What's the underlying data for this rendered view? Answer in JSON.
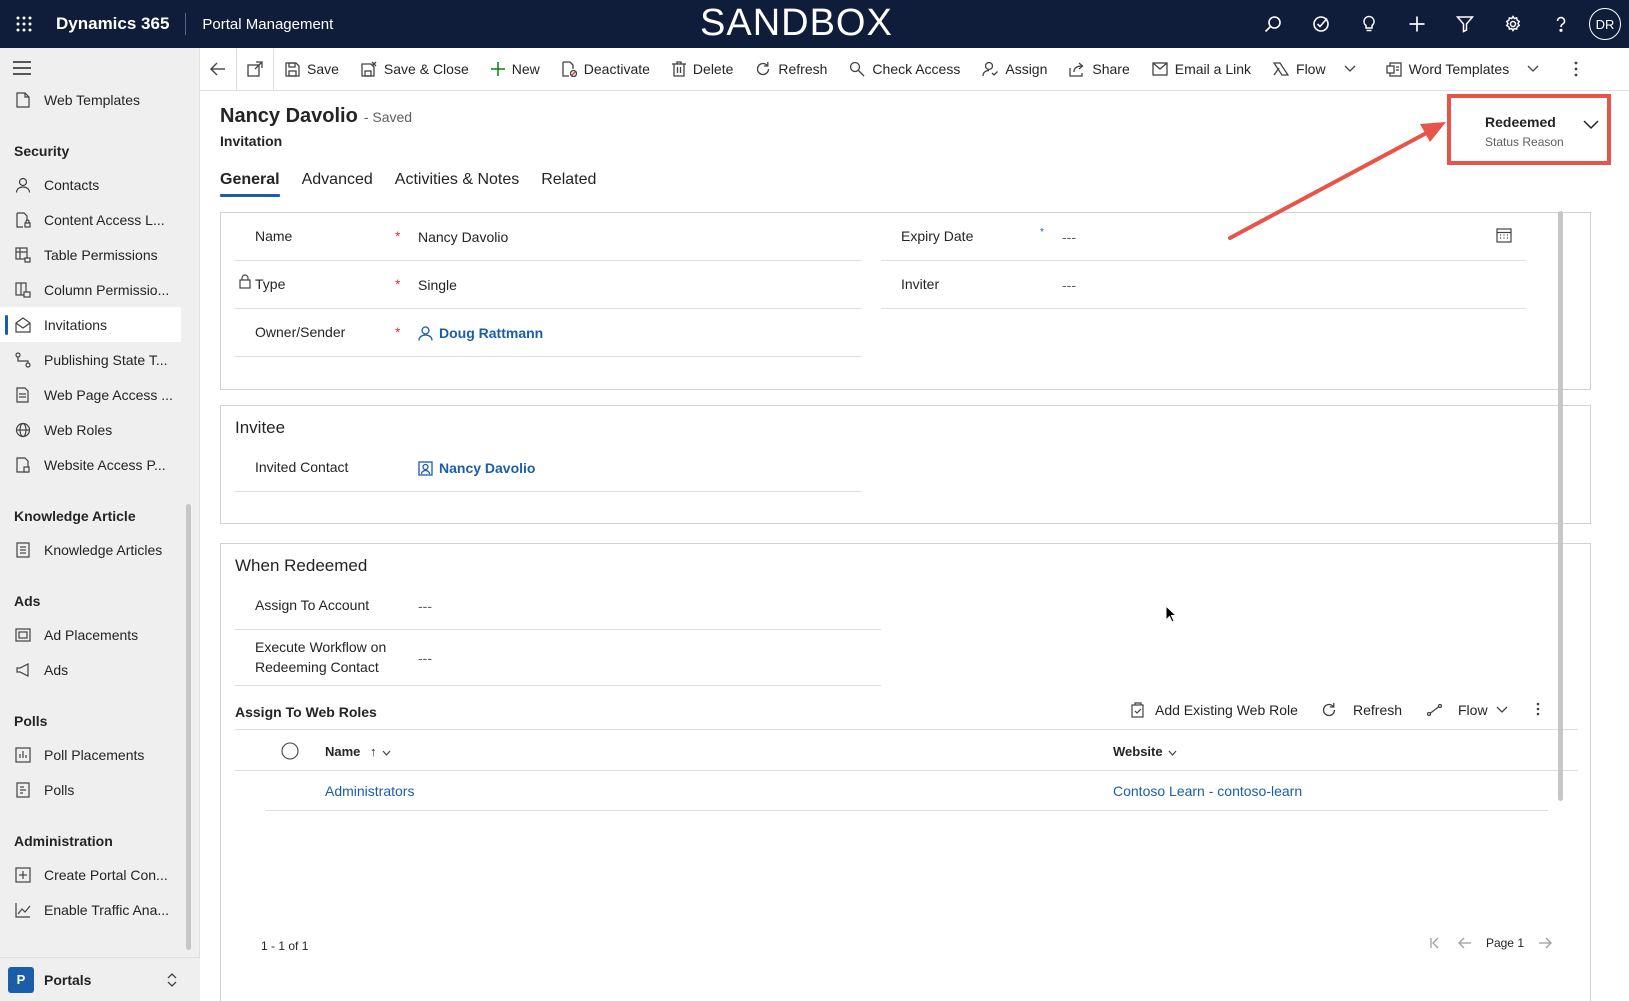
{
  "topbar": {
    "app_name": "Dynamics 365",
    "area_name": "Portal Management",
    "environment": "SANDBOX",
    "icons": [
      "search-icon",
      "task-icon",
      "lightbulb-icon",
      "plus-icon",
      "filter-icon",
      "settings-icon",
      "help-icon"
    ],
    "user_initials": "DR"
  },
  "sidebar": {
    "top_items": [
      {
        "label": "Web Templates",
        "icon": "document-icon"
      }
    ],
    "groups": [
      {
        "title": "Security",
        "items": [
          {
            "label": "Contacts",
            "icon": "person-icon"
          },
          {
            "label": "Content Access L...",
            "icon": "document-lock-icon"
          },
          {
            "label": "Table Permissions",
            "icon": "table-lock-icon"
          },
          {
            "label": "Column Permissio...",
            "icon": "column-icon"
          },
          {
            "label": "Invitations",
            "icon": "mail-icon",
            "active": true
          },
          {
            "label": "Publishing State T...",
            "icon": "flow-icon"
          },
          {
            "label": "Web Page Access ...",
            "icon": "page-access-icon"
          },
          {
            "label": "Web Roles",
            "icon": "globe-icon"
          },
          {
            "label": "Website Access P...",
            "icon": "website-access-icon"
          }
        ]
      },
      {
        "title": "Knowledge Article",
        "items": [
          {
            "label": "Knowledge Articles",
            "icon": "article-icon"
          }
        ]
      },
      {
        "title": "Ads",
        "items": [
          {
            "label": "Ad Placements",
            "icon": "placement-icon"
          },
          {
            "label": "Ads",
            "icon": "megaphone-icon"
          }
        ]
      },
      {
        "title": "Polls",
        "items": [
          {
            "label": "Poll Placements",
            "icon": "poll-placement-icon"
          },
          {
            "label": "Polls",
            "icon": "poll-icon"
          }
        ]
      },
      {
        "title": "Administration",
        "items": [
          {
            "label": "Create Portal Con...",
            "icon": "add-box-icon"
          },
          {
            "label": "Enable Traffic Ana...",
            "icon": "chart-icon"
          }
        ]
      }
    ],
    "footer": {
      "badge": "P",
      "label": "Portals"
    }
  },
  "commandbar": {
    "items": [
      {
        "label": "Save",
        "icon": "save-icon"
      },
      {
        "label": "Save & Close",
        "icon": "save-close-icon"
      },
      {
        "label": "New",
        "icon": "plus-icon"
      },
      {
        "label": "Deactivate",
        "icon": "deactivate-icon"
      },
      {
        "label": "Delete",
        "icon": "trash-icon"
      },
      {
        "label": "Refresh",
        "icon": "refresh-icon"
      },
      {
        "label": "Check Access",
        "icon": "check-access-icon"
      },
      {
        "label": "Assign",
        "icon": "assign-icon"
      },
      {
        "label": "Share",
        "icon": "share-icon"
      },
      {
        "label": "Email a Link",
        "icon": "email-icon"
      },
      {
        "label": "Flow",
        "icon": "flow-icon"
      },
      {
        "label": "Word Templates",
        "icon": "word-icon"
      }
    ]
  },
  "record": {
    "title": "Nancy Davolio",
    "saved_state": "- Saved",
    "entity": "Invitation",
    "status_value": "Redeemed",
    "status_label": "Status Reason"
  },
  "tabs": [
    {
      "label": "General",
      "active": true
    },
    {
      "label": "Advanced"
    },
    {
      "label": "Activities & Notes"
    },
    {
      "label": "Related"
    }
  ],
  "general": {
    "name_label": "Name",
    "name_value": "Nancy Davolio",
    "type_label": "Type",
    "type_value": "Single",
    "owner_label": "Owner/Sender",
    "owner_value": "Doug Rattmann",
    "expiry_label": "Expiry Date",
    "expiry_value": "---",
    "inviter_label": "Inviter",
    "inviter_value": "---",
    "required_mark": "*",
    "recommended_mark": "*"
  },
  "invitee": {
    "title": "Invitee",
    "contact_label": "Invited Contact",
    "contact_value": "Nancy Davolio"
  },
  "redeemed": {
    "title": "When Redeemed",
    "account_label": "Assign To Account",
    "account_value": "---",
    "workflow_label_1": "Execute Workflow on",
    "workflow_label_2": "Redeeming Contact",
    "workflow_value": "---",
    "grid": {
      "title": "Assign To Web Roles",
      "add_label": "Add Existing Web Role",
      "refresh_label": "Refresh",
      "flow_label": "Flow",
      "columns": [
        "Name",
        "Website"
      ],
      "rows": [
        {
          "name": "Administrators",
          "website": "Contoso Learn - contoso-learn"
        }
      ],
      "count": "1 - 1 of 1",
      "page": "Page 1"
    }
  },
  "colors": {
    "nav": "#0f1c3a",
    "accent": "#1a5ea9",
    "highlight": "#e8534a"
  }
}
